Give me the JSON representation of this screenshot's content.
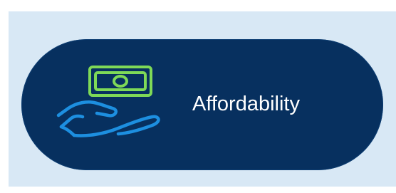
{
  "badge": {
    "label": "Affordability",
    "icon": "hand-holding-money-icon",
    "colors": {
      "background_panel": "#d8e8f5",
      "pill": "#07305f",
      "money": "#7ed957",
      "hand": "#1d8fe0",
      "text": "#ffffff"
    }
  }
}
